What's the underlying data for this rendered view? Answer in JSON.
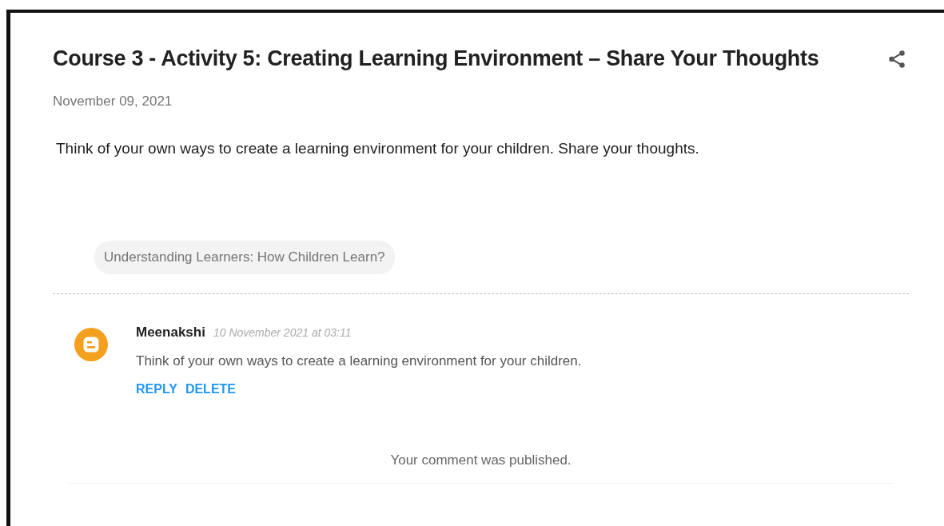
{
  "post": {
    "title": "Course 3 - Activity 5: Creating Learning Environment – Share Your Thoughts",
    "date": "November 09, 2021",
    "body": "Think of your own ways to create a learning environment for your children. Share your thoughts.",
    "labels": [
      "Understanding Learners: How Children Learn?"
    ]
  },
  "comments": [
    {
      "author": "Meenakshi",
      "time": "10 November 2021 at 03:11",
      "text": "Think of your own ways to create a learning environment for your children.",
      "actions": [
        "REPLY",
        "DELETE"
      ]
    }
  ],
  "notice": "Your comment was published."
}
